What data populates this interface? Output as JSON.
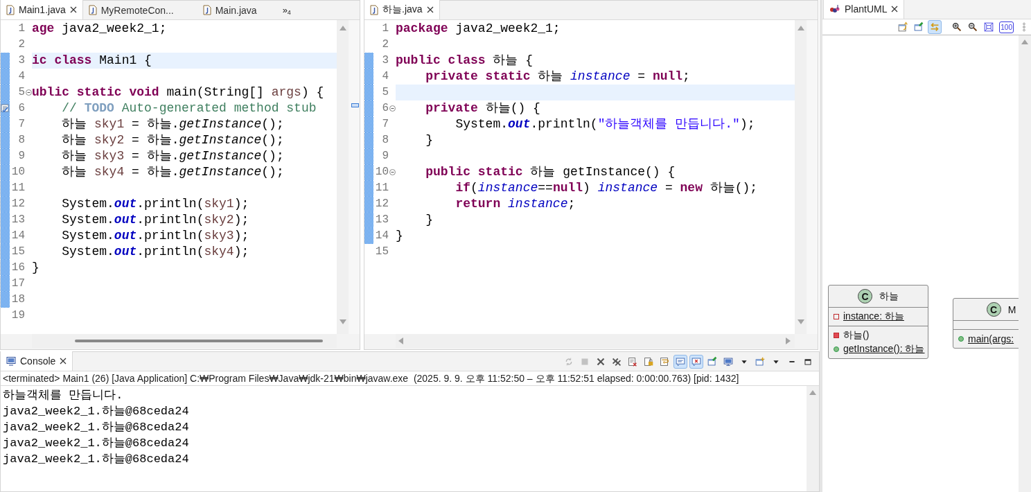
{
  "editors": [
    {
      "tabs": [
        {
          "label": "Main1.java",
          "selected": true
        },
        {
          "label": "MyRemoteCon...",
          "selected": false
        },
        {
          "label": "Main.java",
          "selected": false
        }
      ],
      "overflow": "»",
      "overflow_count": "4",
      "lines": [
        {
          "num": "1",
          "changed": false,
          "current": false,
          "fold": false,
          "task": false,
          "tokens": [
            {
              "kind": "keyword",
              "text": "age"
            },
            {
              "kind": "plain",
              "text": " java2_week2_1;"
            }
          ]
        },
        {
          "num": "2",
          "changed": false,
          "current": false,
          "fold": false,
          "task": false
        },
        {
          "num": "3",
          "changed": true,
          "current": true,
          "fold": false,
          "task": false,
          "tokens": [
            {
              "kind": "keyword",
              "text": "ic class"
            },
            {
              "kind": "plain",
              "text": " Main1 {"
            }
          ]
        },
        {
          "num": "4",
          "changed": true,
          "current": false,
          "fold": false,
          "task": false
        },
        {
          "num": "5",
          "changed": true,
          "current": false,
          "fold": true,
          "task": false,
          "tokens": [
            {
              "kind": "keyword",
              "text": "ublic static void"
            },
            {
              "kind": "plain",
              "text": " main(String[] "
            },
            {
              "kind": "variable",
              "text": "args"
            },
            {
              "kind": "plain",
              "text": ") {"
            }
          ]
        },
        {
          "num": "6",
          "changed": true,
          "current": false,
          "fold": false,
          "task": true,
          "tokens": [
            {
              "kind": "comment",
              "text": "    // "
            },
            {
              "kind": "task-tag",
              "text": "TODO"
            },
            {
              "kind": "comment",
              "text": " Auto-generated method stub"
            }
          ]
        },
        {
          "num": "7",
          "changed": true,
          "current": false,
          "fold": false,
          "task": false,
          "tokens": [
            {
              "kind": "plain",
              "text": "    하늘 "
            },
            {
              "kind": "variable",
              "text": "sky1"
            },
            {
              "kind": "plain",
              "text": " = 하늘."
            },
            {
              "kind": "static-method",
              "text": "getInstance"
            },
            {
              "kind": "plain",
              "text": "();"
            }
          ]
        },
        {
          "num": "8",
          "changed": true,
          "current": false,
          "fold": false,
          "task": false,
          "tokens": [
            {
              "kind": "plain",
              "text": "    하늘 "
            },
            {
              "kind": "variable",
              "text": "sky2"
            },
            {
              "kind": "plain",
              "text": " = 하늘."
            },
            {
              "kind": "static-method",
              "text": "getInstance"
            },
            {
              "kind": "plain",
              "text": "();"
            }
          ]
        },
        {
          "num": "9",
          "changed": true,
          "current": false,
          "fold": false,
          "task": false,
          "tokens": [
            {
              "kind": "plain",
              "text": "    하늘 "
            },
            {
              "kind": "variable",
              "text": "sky3"
            },
            {
              "kind": "plain",
              "text": " = 하늘."
            },
            {
              "kind": "static-method",
              "text": "getInstance"
            },
            {
              "kind": "plain",
              "text": "();"
            }
          ]
        },
        {
          "num": "10",
          "changed": true,
          "current": false,
          "fold": false,
          "task": false,
          "tokens": [
            {
              "kind": "plain",
              "text": "    하늘 "
            },
            {
              "kind": "variable",
              "text": "sky4"
            },
            {
              "kind": "plain",
              "text": " = 하늘."
            },
            {
              "kind": "static-method",
              "text": "getInstance"
            },
            {
              "kind": "plain",
              "text": "();"
            }
          ]
        },
        {
          "num": "11",
          "changed": true,
          "current": false,
          "fold": false,
          "task": false
        },
        {
          "num": "12",
          "changed": true,
          "current": false,
          "fold": false,
          "task": false,
          "tokens": [
            {
              "kind": "plain",
              "text": "    System."
            },
            {
              "kind": "static-field",
              "text": "out"
            },
            {
              "kind": "plain",
              "text": ".println("
            },
            {
              "kind": "variable",
              "text": "sky1"
            },
            {
              "kind": "plain",
              "text": ");"
            }
          ]
        },
        {
          "num": "13",
          "changed": true,
          "current": false,
          "fold": false,
          "task": false,
          "tokens": [
            {
              "kind": "plain",
              "text": "    System."
            },
            {
              "kind": "static-field",
              "text": "out"
            },
            {
              "kind": "plain",
              "text": ".println("
            },
            {
              "kind": "variable",
              "text": "sky2"
            },
            {
              "kind": "plain",
              "text": ");"
            }
          ]
        },
        {
          "num": "14",
          "changed": true,
          "current": false,
          "fold": false,
          "task": false,
          "tokens": [
            {
              "kind": "plain",
              "text": "    System."
            },
            {
              "kind": "static-field",
              "text": "out"
            },
            {
              "kind": "plain",
              "text": ".println("
            },
            {
              "kind": "variable",
              "text": "sky3"
            },
            {
              "kind": "plain",
              "text": ");"
            }
          ]
        },
        {
          "num": "15",
          "changed": true,
          "current": false,
          "fold": false,
          "task": false,
          "tokens": [
            {
              "kind": "plain",
              "text": "    System."
            },
            {
              "kind": "static-field",
              "text": "out"
            },
            {
              "kind": "plain",
              "text": ".println("
            },
            {
              "kind": "variable",
              "text": "sky4"
            },
            {
              "kind": "plain",
              "text": ");"
            }
          ]
        },
        {
          "num": "16",
          "changed": true,
          "current": false,
          "fold": false,
          "task": false,
          "tokens": [
            {
              "kind": "plain",
              "text": "}"
            }
          ]
        },
        {
          "num": "17",
          "changed": true,
          "current": false,
          "fold": false,
          "task": false
        },
        {
          "num": "18",
          "changed": true,
          "current": false,
          "fold": false,
          "task": false
        },
        {
          "num": "19",
          "changed": false,
          "current": false,
          "fold": false,
          "task": false
        }
      ]
    },
    {
      "tabs": [
        {
          "label": "하늘.java",
          "selected": true
        }
      ],
      "lines": [
        {
          "num": "1",
          "changed": false,
          "current": false,
          "fold": false,
          "task": false,
          "tokens": [
            {
              "kind": "keyword",
              "text": "package"
            },
            {
              "kind": "plain",
              "text": " java2_week2_1;"
            }
          ]
        },
        {
          "num": "2",
          "changed": false,
          "current": false,
          "fold": false,
          "task": false
        },
        {
          "num": "3",
          "changed": true,
          "current": false,
          "fold": false,
          "task": false,
          "tokens": [
            {
              "kind": "keyword",
              "text": "public class"
            },
            {
              "kind": "plain",
              "text": " 하늘 {"
            }
          ]
        },
        {
          "num": "4",
          "changed": true,
          "current": false,
          "fold": false,
          "task": false,
          "tokens": [
            {
              "kind": "keyword",
              "text": "    private static"
            },
            {
              "kind": "plain",
              "text": " 하늘 "
            },
            {
              "kind": "field",
              "text": "instance"
            },
            {
              "kind": "plain",
              "text": " = "
            },
            {
              "kind": "keyword",
              "text": "null"
            },
            {
              "kind": "plain",
              "text": ";"
            }
          ]
        },
        {
          "num": "5",
          "changed": true,
          "current": true,
          "fold": false,
          "task": false
        },
        {
          "num": "6",
          "changed": true,
          "current": false,
          "fold": true,
          "task": false,
          "tokens": [
            {
              "kind": "keyword",
              "text": "    private"
            },
            {
              "kind": "plain",
              "text": " 하늘() {"
            }
          ]
        },
        {
          "num": "7",
          "changed": true,
          "current": false,
          "fold": false,
          "task": false,
          "tokens": [
            {
              "kind": "plain",
              "text": "        System."
            },
            {
              "kind": "static-field",
              "text": "out"
            },
            {
              "kind": "plain",
              "text": ".println("
            },
            {
              "kind": "string",
              "text": "\"하늘객체를 만듭니다.\""
            },
            {
              "kind": "plain",
              "text": ");"
            }
          ]
        },
        {
          "num": "8",
          "changed": true,
          "current": false,
          "fold": false,
          "task": false,
          "tokens": [
            {
              "kind": "plain",
              "text": "    }"
            }
          ]
        },
        {
          "num": "9",
          "changed": true,
          "current": false,
          "fold": false,
          "task": false
        },
        {
          "num": "10",
          "changed": true,
          "current": false,
          "fold": true,
          "task": false,
          "tokens": [
            {
              "kind": "keyword",
              "text": "    public static"
            },
            {
              "kind": "plain",
              "text": " 하늘 getInstance() {"
            }
          ]
        },
        {
          "num": "11",
          "changed": true,
          "current": false,
          "fold": false,
          "task": false,
          "tokens": [
            {
              "kind": "keyword",
              "text": "        if"
            },
            {
              "kind": "plain",
              "text": "("
            },
            {
              "kind": "field",
              "text": "instance"
            },
            {
              "kind": "plain",
              "text": "=="
            },
            {
              "kind": "keyword",
              "text": "null"
            },
            {
              "kind": "plain",
              "text": ") "
            },
            {
              "kind": "field",
              "text": "instance"
            },
            {
              "kind": "plain",
              "text": " = "
            },
            {
              "kind": "keyword",
              "text": "new"
            },
            {
              "kind": "plain",
              "text": " 하늘();"
            }
          ]
        },
        {
          "num": "12",
          "changed": true,
          "current": false,
          "fold": false,
          "task": false,
          "tokens": [
            {
              "kind": "keyword",
              "text": "        return "
            },
            {
              "kind": "field",
              "text": "instance"
            },
            {
              "kind": "plain",
              "text": ";"
            }
          ]
        },
        {
          "num": "13",
          "changed": true,
          "current": false,
          "fold": false,
          "task": false,
          "tokens": [
            {
              "kind": "plain",
              "text": "    }"
            }
          ]
        },
        {
          "num": "14",
          "changed": true,
          "current": false,
          "fold": false,
          "task": false,
          "tokens": [
            {
              "kind": "plain",
              "text": "}"
            }
          ]
        },
        {
          "num": "15",
          "changed": false,
          "current": false,
          "fold": false,
          "task": false
        }
      ]
    }
  ],
  "console": {
    "tab": {
      "label": "Console",
      "selected": true
    },
    "toolbar": [
      {
        "kind": "refresh",
        "selected": false,
        "disabled": true
      },
      {
        "kind": "stop",
        "selected": false,
        "disabled": true
      },
      {
        "kind": "remove",
        "selected": false,
        "disabled": false
      },
      {
        "kind": "remove-all",
        "selected": false,
        "disabled": false
      },
      {
        "kind": "clear",
        "selected": false,
        "disabled": false
      },
      {
        "kind": "lock",
        "selected": false,
        "disabled": false
      },
      {
        "kind": "wrap",
        "selected": false,
        "disabled": false
      },
      {
        "kind": "show-out",
        "selected": true,
        "disabled": false
      },
      {
        "kind": "show-err",
        "selected": true,
        "disabled": false
      },
      {
        "kind": "pin",
        "selected": false,
        "disabled": false
      },
      {
        "kind": "display",
        "selected": false,
        "disabled": false
      },
      {
        "kind": "caret",
        "selected": false,
        "disabled": false
      },
      {
        "kind": "open",
        "selected": false,
        "disabled": false
      },
      {
        "kind": "caret",
        "selected": false,
        "disabled": false
      },
      {
        "kind": "minimize",
        "selected": false,
        "disabled": false
      },
      {
        "kind": "maximize",
        "selected": false,
        "disabled": false
      }
    ],
    "status": "<terminated> Main1 (26) [Java Application] C:₩Program Files₩Java₩jdk-21₩bin₩javaw.exe  (2025. 9. 9. 오후 11:52:50 – 오후 11:52:51 elapsed: 0:00:00.763) [pid: 1432]",
    "output": [
      "하늘객체를 만듭니다.",
      "java2_week2_1.하늘@68ceda24",
      "java2_week2_1.하늘@68ceda24",
      "java2_week2_1.하늘@68ceda24",
      "java2_week2_1.하늘@68ceda24"
    ]
  },
  "plantuml": {
    "tab": {
      "label": "PlantUML",
      "selected": true
    },
    "toolbar": [
      {
        "kind": "export",
        "selected": false
      },
      {
        "kind": "pin",
        "selected": false
      },
      {
        "kind": "link",
        "selected": true
      },
      {
        "kind": "zoom-in",
        "selected": false
      },
      {
        "kind": "zoom-out",
        "selected": false
      },
      {
        "kind": "fit",
        "selected": false
      },
      {
        "kind": "actual",
        "label": "100",
        "selected": false
      },
      {
        "kind": "more",
        "selected": false
      }
    ],
    "classes": [
      {
        "badge": "C",
        "name": "하늘",
        "members": [
          {
            "kind": "field",
            "public": false,
            "static": true,
            "text": "instance: 하늘"
          },
          {
            "kind": "method",
            "public": false,
            "static": false,
            "text": "하늘()"
          },
          {
            "kind": "method",
            "public": true,
            "static": true,
            "text": "getInstance(): 하늘"
          }
        ]
      },
      {
        "badge": "C",
        "name": "M",
        "members": [
          {
            "kind": "method",
            "public": true,
            "static": true,
            "text": "main(args:"
          }
        ]
      }
    ]
  }
}
